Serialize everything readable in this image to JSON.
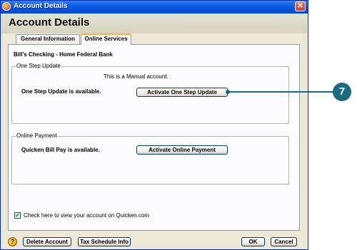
{
  "window": {
    "title": "Account Details",
    "close_glyph": "✕",
    "icon": "quicken-app-icon"
  },
  "page": {
    "title": "Account Details"
  },
  "tabs": [
    {
      "label": "General Information",
      "active": false
    },
    {
      "label": "Online Services",
      "active": true
    }
  ],
  "account": {
    "name": "Bill's Checking - Home Federal Bank"
  },
  "one_step_update": {
    "legend": "One Step Update",
    "manual_note": "This is a Manual account.",
    "status": "One Step Update is available.",
    "button_label": "Activate One Step Update"
  },
  "online_payment": {
    "legend": "Online Payment",
    "status": "Quicken Bill Pay is available.",
    "button_label": "Activate Online Payment"
  },
  "view_online": {
    "checked": true,
    "check_glyph": "✔",
    "label": "Check here to view your account on Quicken.com"
  },
  "footer": {
    "help_glyph": "?",
    "delete_label": "Delete Account",
    "tax_label": "Tax Schedule Info",
    "ok_label": "OK",
    "cancel_label": "Cancel"
  },
  "callout": {
    "number": "7"
  },
  "colors": {
    "titlebar": "#0a5ce6",
    "callout": "#1c6a7e",
    "tab_highlight": "#f8b040"
  }
}
